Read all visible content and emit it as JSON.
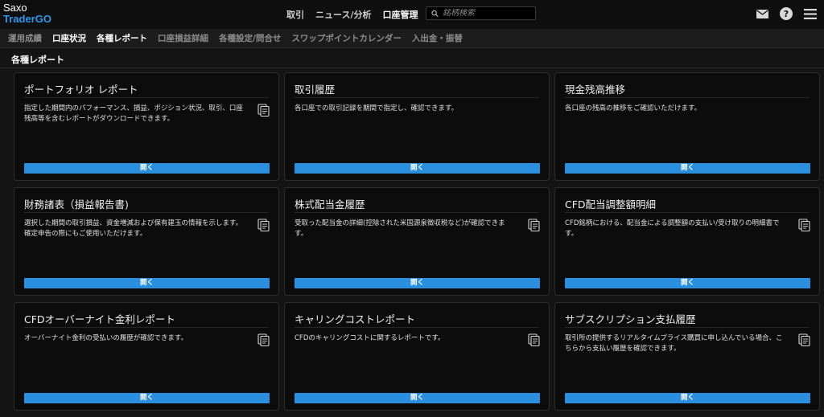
{
  "brand": {
    "line1": "Saxo",
    "line2": "TraderGO"
  },
  "top_nav": [
    {
      "label": "取引",
      "active": false
    },
    {
      "label": "ニュース/分析",
      "active": false
    },
    {
      "label": "口座管理",
      "active": true
    }
  ],
  "search": {
    "placeholder": "銘柄検索"
  },
  "icons": {
    "search": "search-icon",
    "mail": "mail-icon",
    "help": "help-icon",
    "menu": "hamburger-menu-icon",
    "document": "document-stack-icon"
  },
  "sub_nav": [
    {
      "label": "運用成績",
      "white": false
    },
    {
      "label": "口座状況",
      "white": true
    },
    {
      "label": "各種レポート",
      "white": true
    },
    {
      "label": "口座損益詳細",
      "white": false
    },
    {
      "label": "各種設定/問合せ",
      "white": false
    },
    {
      "label": "スワップポイントカレンダー",
      "white": false
    },
    {
      "label": "入出金・振替",
      "white": false
    }
  ],
  "section": {
    "title": "各種レポート"
  },
  "colors": {
    "accent": "#2b8fdf",
    "brand_blue": "#2f97f0"
  },
  "cards": [
    {
      "title": "ポートフォリオ レポート",
      "desc": "指定した期間内のパフォーマンス、損益、ポジション状況、取引、口座残高等を含むレポートがダウンロードできます。",
      "button": "開く"
    },
    {
      "title": "取引履歴",
      "desc": "各口座での取引記録を期間で指定し、確認できます。",
      "button": "開く"
    },
    {
      "title": "現金残高推移",
      "desc": "各口座の残高の推移をご確認いただけます。",
      "button": "開く"
    },
    {
      "title": "財務諸表（損益報告書)",
      "desc": "選択した期間の取引損益、資金増減および保有建玉の情報を示します。確定申告の際にもご使用いただけます。",
      "button": "開く"
    },
    {
      "title": "株式配当金履歴",
      "desc": "受取った配当金の詳細(控除された米国源泉徴収税など)が確認できます。",
      "button": "開く"
    },
    {
      "title": "CFD配当調整額明細",
      "desc": "CFD銘柄における、配当金による調整額の支払い/受け取りの明細書です。",
      "button": "開く"
    },
    {
      "title": "CFDオーバーナイト金利レポート",
      "desc": "オーバーナイト金利の受払いの履歴が確認できます。",
      "button": "開く"
    },
    {
      "title": "キャリングコストレポート",
      "desc": "CFDのキャリングコストに関するレポートです。",
      "button": "開く"
    },
    {
      "title": "サブスクリプション支払履歴",
      "desc": "取引所の提供するリアルタイムプライス購買に申し込んでいる場合、こちらから支払い履歴を確認できます。",
      "button": "開く"
    }
  ]
}
